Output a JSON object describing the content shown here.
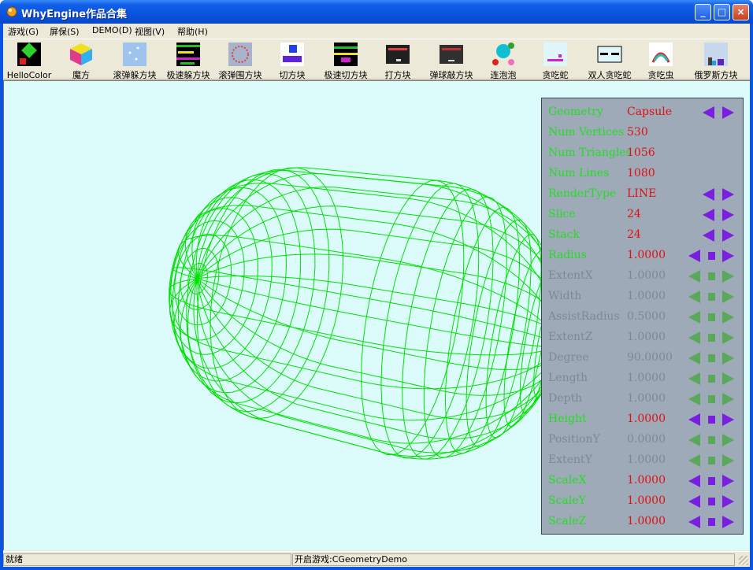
{
  "window": {
    "title": "WhyEngine作品合集",
    "minimize": "_",
    "maximize": "□",
    "close": "×"
  },
  "menu": [
    {
      "label": "游戏(G)"
    },
    {
      "label": "屏保(S)"
    },
    {
      "label": "DEMO(D)"
    },
    {
      "label": "视图(V)"
    },
    {
      "label": "帮助(H)"
    }
  ],
  "toolbar": [
    {
      "label": "HelloColor",
      "icon": "hellocolor-icon"
    },
    {
      "label": "魔方",
      "icon": "rubiks-cube-icon"
    },
    {
      "label": "滚弹躲方块",
      "icon": "roll-dodge-icon"
    },
    {
      "label": "极速躲方块",
      "icon": "speed-dodge-icon"
    },
    {
      "label": "滚弹围方块",
      "icon": "roll-surround-icon"
    },
    {
      "label": "切方块",
      "icon": "cut-block-icon"
    },
    {
      "label": "极速切方块",
      "icon": "speed-cut-icon"
    },
    {
      "label": "打方块",
      "icon": "hit-block-icon"
    },
    {
      "label": "弹球敲方块",
      "icon": "pinball-icon"
    },
    {
      "label": "连泡泡",
      "icon": "bubble-icon"
    },
    {
      "label": "贪吃蛇",
      "icon": "snake-icon"
    },
    {
      "label": "双人贪吃蛇",
      "icon": "two-player-snake-icon"
    },
    {
      "label": "贪吃虫",
      "icon": "worm-icon"
    },
    {
      "label": "俄罗斯方块",
      "icon": "tetris-icon"
    }
  ],
  "panel": {
    "rows": [
      {
        "name": "Geometry",
        "value": "Capsule",
        "enabled": true,
        "controls": "lr"
      },
      {
        "name": "Num Vertices",
        "value": "530",
        "enabled": true,
        "controls": ""
      },
      {
        "name": "Num Triangles",
        "value": "1056",
        "enabled": true,
        "controls": ""
      },
      {
        "name": "Num Lines",
        "value": "1080",
        "enabled": true,
        "controls": ""
      },
      {
        "name": "RenderType",
        "value": "LINE",
        "enabled": true,
        "controls": "lr"
      },
      {
        "name": "Slice",
        "value": "24",
        "enabled": true,
        "controls": "lr"
      },
      {
        "name": "Stack",
        "value": "24",
        "enabled": true,
        "controls": "lr"
      },
      {
        "name": "Radius",
        "value": "1.0000",
        "enabled": true,
        "controls": "lsr"
      },
      {
        "name": "ExtentX",
        "value": "1.0000",
        "enabled": false,
        "controls": "lsr"
      },
      {
        "name": "Width",
        "value": "1.0000",
        "enabled": false,
        "controls": "lsr"
      },
      {
        "name": "AssistRadius",
        "value": "0.5000",
        "enabled": false,
        "controls": "lsr"
      },
      {
        "name": "ExtentZ",
        "value": "1.0000",
        "enabled": false,
        "controls": "lsr"
      },
      {
        "name": "Degree",
        "value": "90.0000",
        "enabled": false,
        "controls": "lsr"
      },
      {
        "name": "Length",
        "value": "1.0000",
        "enabled": false,
        "controls": "lsr"
      },
      {
        "name": "Depth",
        "value": "1.0000",
        "enabled": false,
        "controls": "lsr"
      },
      {
        "name": "Height",
        "value": "1.0000",
        "enabled": true,
        "controls": "lsr"
      },
      {
        "name": "PositionY",
        "value": "0.0000",
        "enabled": false,
        "controls": "lsr"
      },
      {
        "name": "ExtentY",
        "value": "1.0000",
        "enabled": false,
        "controls": "lsr"
      },
      {
        "name": "ScaleX",
        "value": "1.0000",
        "enabled": true,
        "controls": "lsr"
      },
      {
        "name": "ScaleY",
        "value": "1.0000",
        "enabled": true,
        "controls": "lsr"
      },
      {
        "name": "ScaleZ",
        "value": "1.0000",
        "enabled": true,
        "controls": "lsr"
      }
    ]
  },
  "status": {
    "left": "就绪",
    "right": "开启游戏:CGeometryDemo"
  },
  "colors": {
    "viewport_bg": "#dcfbfb",
    "wire": "#00e000",
    "panel_bg": "#9faab8",
    "name_enabled": "#22dd22",
    "name_disabled": "#7d8896",
    "value_enabled": "#e01010",
    "value_disabled": "#7d8896",
    "arrow_enabled": "#7a1fe0",
    "arrow_disabled": "#5aa85a"
  }
}
